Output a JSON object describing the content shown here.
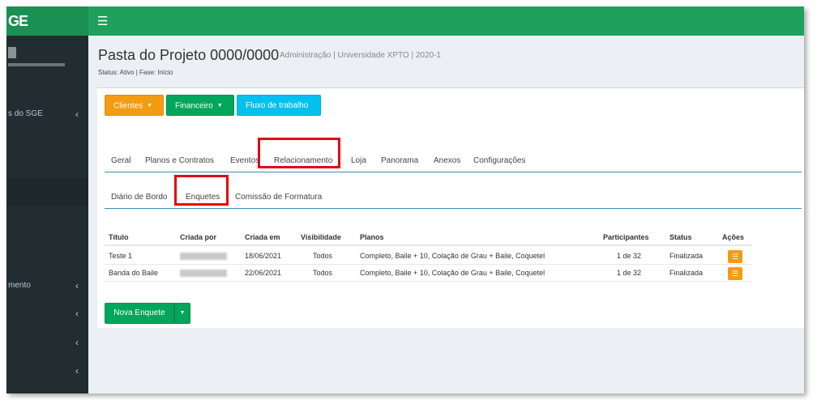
{
  "app": {
    "logo": "GE",
    "menu_icon": "☰"
  },
  "sidebar": {
    "items": [
      {
        "label": "s do SGE"
      },
      {
        "label": "mento"
      },
      {
        "label": ""
      },
      {
        "label": ""
      },
      {
        "label": ""
      }
    ],
    "chevron": "‹"
  },
  "header": {
    "title": "Pasta do Projeto 0000/0000",
    "subtitle": "Administração | Universidade XPTO | 2020-1",
    "status": "Status: Ativo | Fase: Início"
  },
  "toolbar": {
    "clientes": "Clientes",
    "financeiro": "Financeiro",
    "fluxo": "Fluxo de trabalho",
    "caret": "▼"
  },
  "tabs": {
    "main": [
      "Geral",
      "Planos e Contratos",
      "Eventos",
      "Relacionamento",
      "Loja",
      "Panorama",
      "Anexos",
      "Configurações"
    ],
    "sub": [
      "Diário de Bordo",
      "Enquetes",
      "Comissão de Formatura"
    ]
  },
  "table": {
    "headers": [
      "Título",
      "Criada por",
      "Criada em",
      "Visibilidade",
      "Planos",
      "Participantes",
      "Status",
      "Ações"
    ],
    "rows": [
      {
        "titulo": "Teste 1",
        "criada_em": "18/06/2021",
        "visibilidade": "Todos",
        "planos": "Completo, Baile + 10, Colação de Grau + Baile, Coquetel",
        "participantes": "1 de 32",
        "status": "Finalizada"
      },
      {
        "titulo": "Banda do Baile",
        "criada_em": "22/06/2021",
        "visibilidade": "Todos",
        "planos": "Completo, Baile + 10, Colação de Grau + Baile, Coquetel",
        "participantes": "1 de 32",
        "status": "Finalizada"
      }
    ],
    "actions_icon": "☰"
  },
  "footer_actions": {
    "nova_enquete": "Nova Enquete",
    "caret": "▼"
  },
  "colors": {
    "topbar": "#1fa15d",
    "sidebar": "#222d32",
    "orange": "#f39c12",
    "green": "#00a65a",
    "cyan": "#00c0ef",
    "highlight": "#e30613"
  }
}
